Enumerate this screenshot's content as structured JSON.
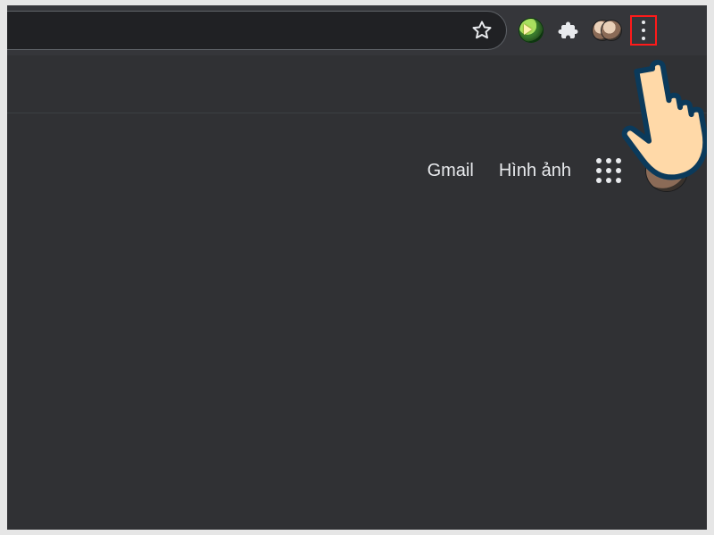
{
  "colors": {
    "bg": "#303134",
    "toolbar": "#35363a",
    "highlight": "#ff1a1a",
    "text": "#e8eaed"
  },
  "toolbar": {
    "icons": {
      "star": "bookmark-star",
      "download_manager": "idm",
      "extensions": "extensions-puzzle",
      "profile": "profile-avatar",
      "menu": "chrome-menu"
    }
  },
  "page_header": {
    "links": {
      "gmail": "Gmail",
      "images": "Hình ảnh"
    },
    "apps_icon": "google-apps",
    "account_icon": "account-avatar"
  },
  "annotation": {
    "pointer": "hand-click",
    "highlight_target": "chrome-menu"
  }
}
